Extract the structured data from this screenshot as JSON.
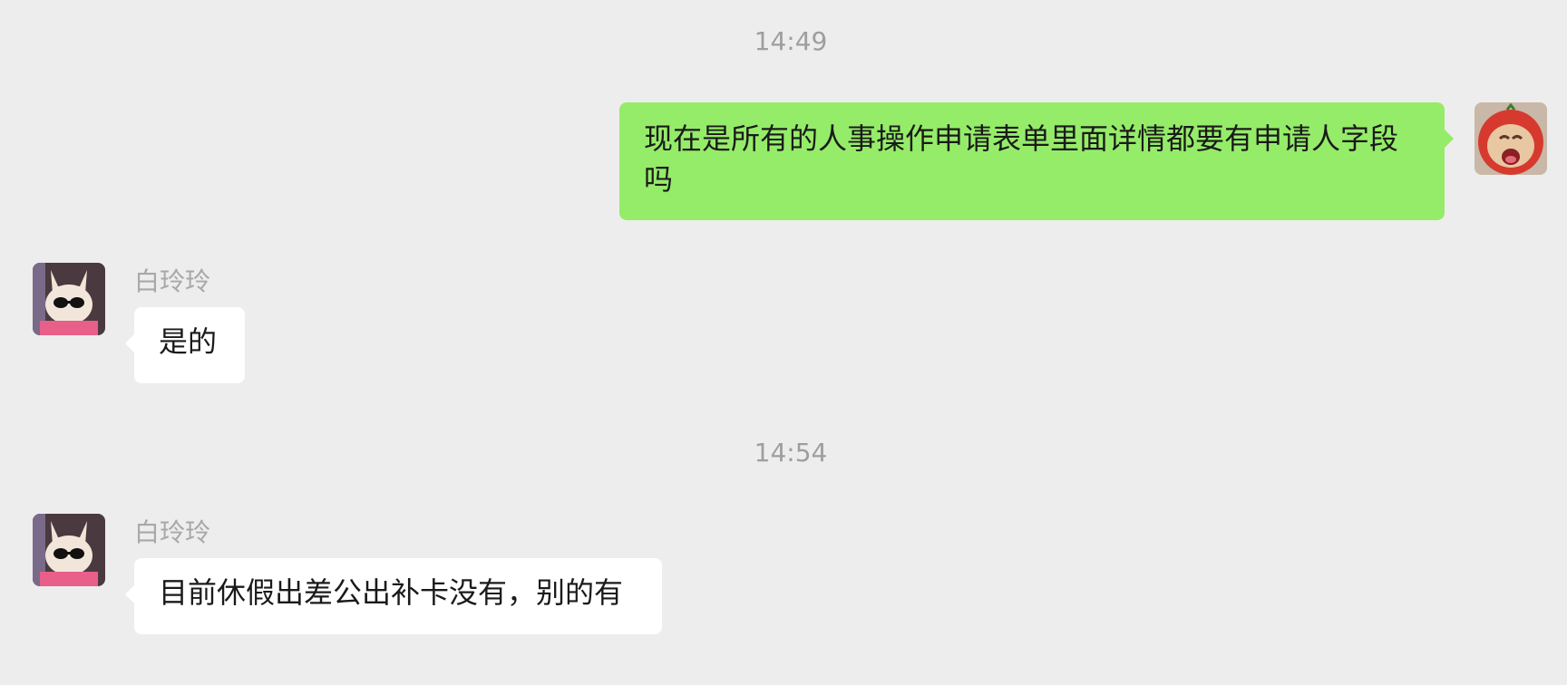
{
  "timestamps": [
    "14:49",
    "14:54"
  ],
  "messages": [
    {
      "direction": "outgoing",
      "text": "现在是所有的人事操作申请表单里面详情都要有申请人字段吗",
      "avatar": "tomato-hat-dog-avatar"
    },
    {
      "direction": "incoming",
      "sender": "白玲玲",
      "text": "是的",
      "avatar": "sunglasses-cat-avatar"
    },
    {
      "direction": "incoming",
      "sender": "白玲玲",
      "text": "目前休假出差公出补卡没有，别的有",
      "avatar": "sunglasses-cat-avatar"
    }
  ],
  "colors": {
    "background": "#ededed",
    "outgoing_bubble": "#95ec69",
    "incoming_bubble": "#ffffff",
    "timestamp_text": "#9e9e9e",
    "sender_name_text": "#a8a8a8",
    "message_text": "#1a1a1a"
  }
}
